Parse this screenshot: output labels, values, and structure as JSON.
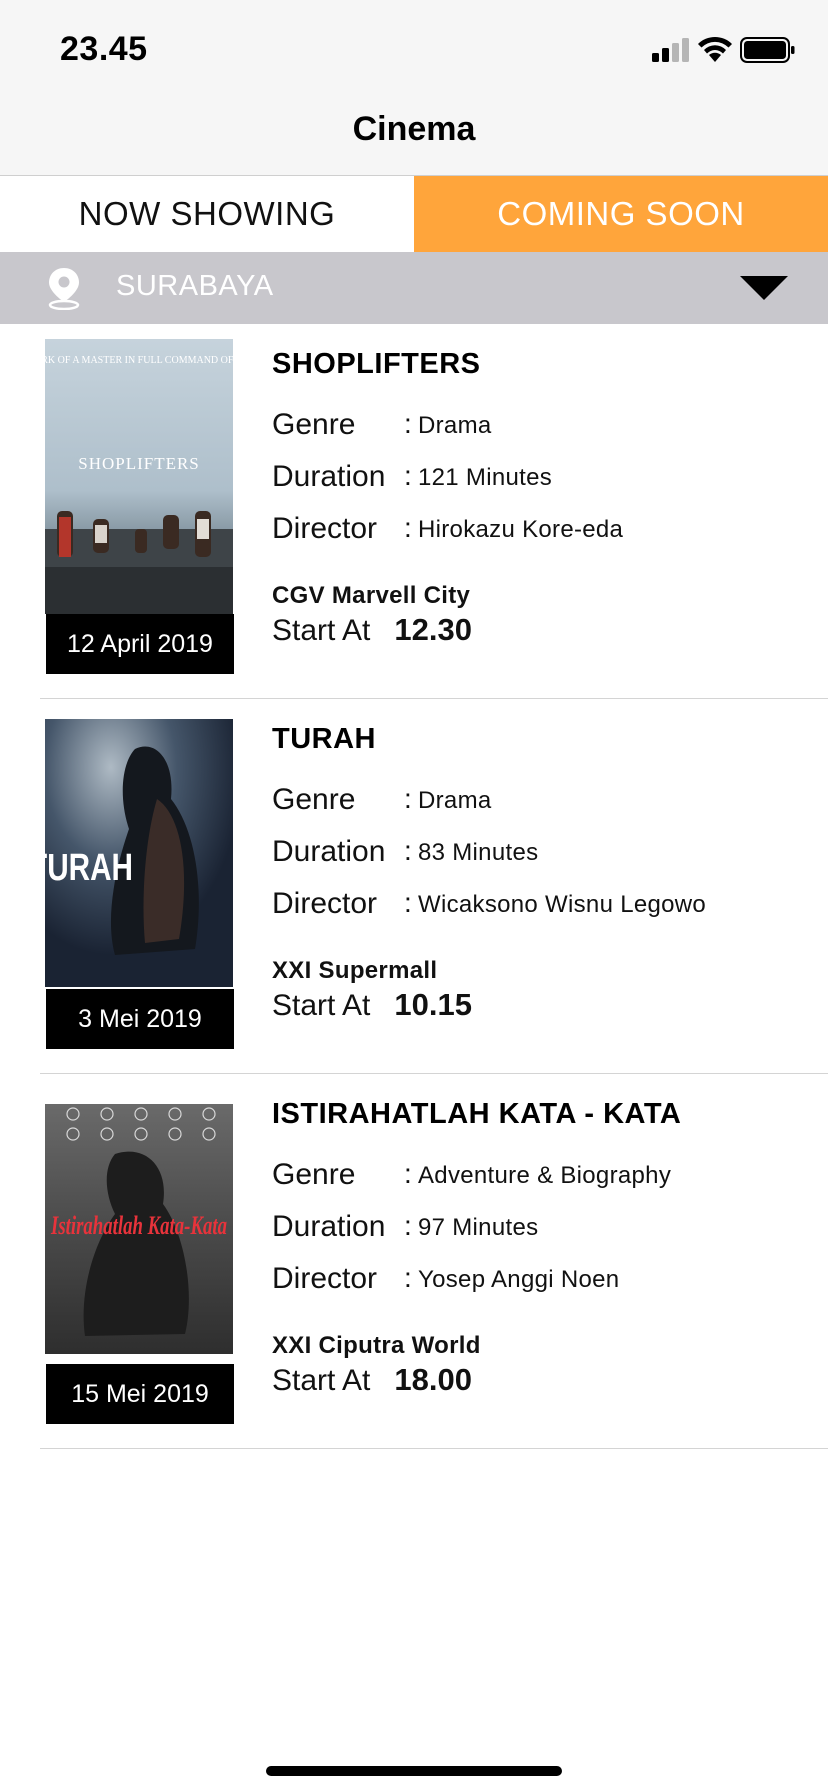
{
  "status_bar": {
    "time": "23.45"
  },
  "nav": {
    "title": "Cinema"
  },
  "tabs": [
    {
      "label": "NOW SHOWING",
      "active": false
    },
    {
      "label": "COMING SOON",
      "active": true
    }
  ],
  "location": {
    "city": "SURABAYA"
  },
  "colors": {
    "accent": "#ffa53b",
    "location_bar": "#c8c7cc",
    "badge": "#000000"
  },
  "labels": {
    "genre": "Genre",
    "duration": "Duration",
    "director": "Director",
    "start_at": "Start At",
    "colon": ":"
  },
  "movies": [
    {
      "title": "SHOPLIFTERS",
      "genre": "Drama",
      "duration": "121 Minutes",
      "director": "Hirokazu Kore-eda",
      "cinema": "CGV Marvell City",
      "start_time": "12.30",
      "date": "12 April 2019",
      "poster": {
        "tagline": "\"THE WORK OF A MASTER IN FULL COMMAND OF HIS ART.\"",
        "title": "SHOPLIFTERS"
      }
    },
    {
      "title": "TURAH",
      "genre": "Drama",
      "duration": "83 Minutes",
      "director": "Wicaksono Wisnu Legowo",
      "cinema": "XXI Supermall",
      "start_time": "10.15",
      "date": "3 Mei 2019",
      "poster": {
        "title": "TURAH"
      }
    },
    {
      "title": "ISTIRAHATLAH KATA - KATA",
      "genre": "Adventure & Biography",
      "duration": "97 Minutes",
      "director": "Yosep Anggi Noen",
      "cinema": "XXI Ciputra World",
      "start_time": "18.00",
      "date": "15 Mei 2019",
      "poster": {
        "title": "Istirahatlah Kata-Kata"
      }
    }
  ]
}
